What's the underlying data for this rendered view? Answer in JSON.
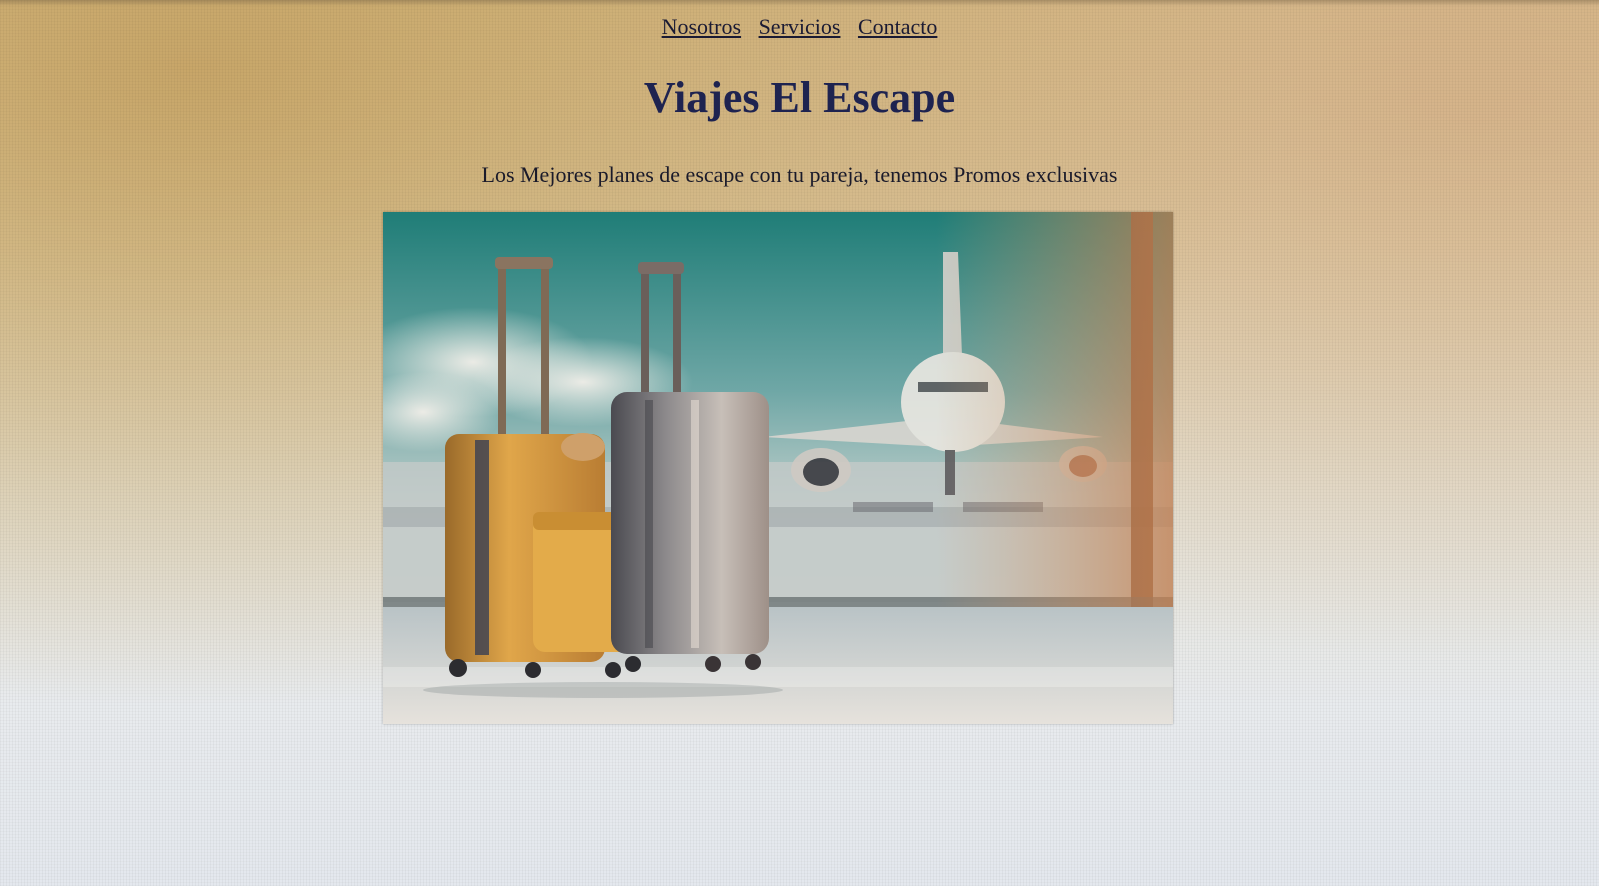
{
  "nav": {
    "items": [
      {
        "label": "Nosotros"
      },
      {
        "label": "Servicios"
      },
      {
        "label": "Contacto"
      }
    ]
  },
  "header": {
    "title": "Viajes El Escape",
    "tagline": "Los Mejores planes de escape con tu pareja, tenemos Promos exclusivas"
  },
  "hero": {
    "icon": "airport-luggage-image"
  },
  "colors": {
    "title": "#1e2350",
    "text": "#1a1a2a",
    "link": "#1a1a33"
  }
}
